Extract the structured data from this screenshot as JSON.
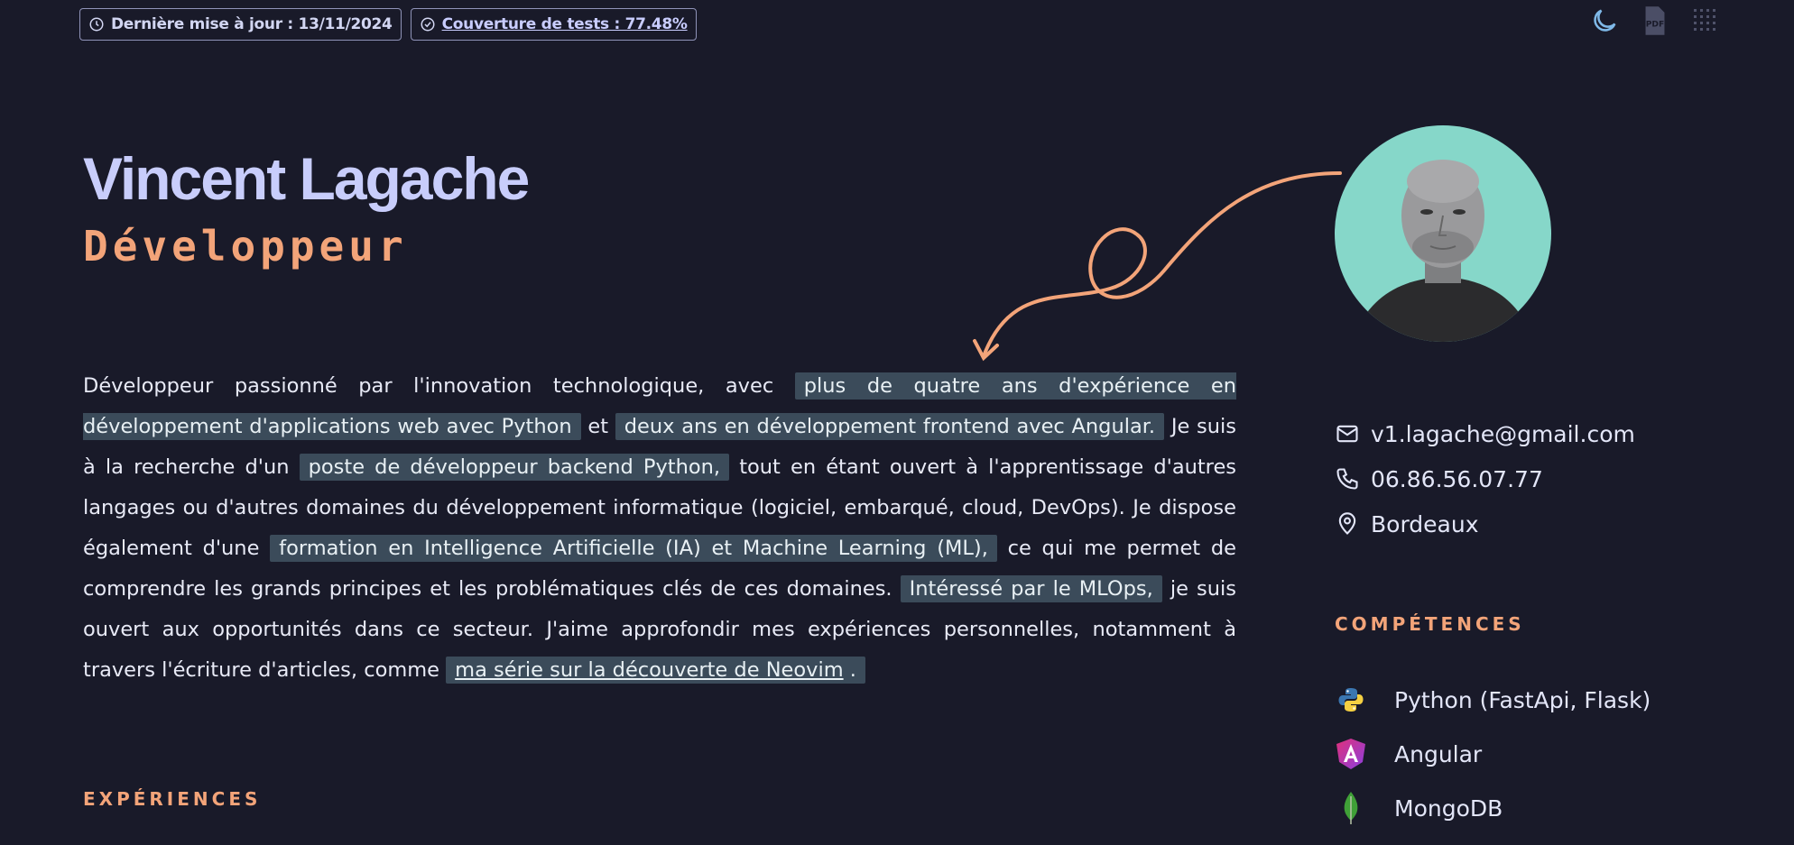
{
  "header": {
    "last_update": "Dernière mise à jour : 13/11/2024",
    "test_coverage": "Couverture de tests : 77.48%",
    "icons": [
      "moon-icon",
      "pdf-icon",
      "grid-icon"
    ]
  },
  "hero": {
    "name": "Vincent Lagache",
    "role": "Développeur"
  },
  "bio": {
    "p1": "Développeur passionné par l'innovation technologique, avec ",
    "h1": "plus de quatre ans d'expérience en développement d'applications web avec Python",
    "p2": " et ",
    "h2": "deux ans en développement frontend avec Angular.",
    "p3": " Je suis à la recherche d'un ",
    "h3": "poste de développeur backend Python,",
    "p4": " tout en étant ouvert à l'apprentissage d'autres langages ou d'autres domaines du développement informatique (logiciel, embarqué, cloud, DevOps). Je dispose également d'une ",
    "h4": "formation en Intelligence Artificielle (IA) et Machine Learning (ML),",
    "p5": " ce qui me permet de comprendre les grands principes et les problématiques clés de ces domaines. ",
    "h5": "Intéressé par le MLOps,",
    "p6": " je suis ouvert aux opportunités dans ce secteur. J'aime approfondir mes expériences personnelles, notamment à travers l'écriture d'articles, comme ",
    "link": "ma série sur la découverte de Neovim",
    "link_suffix": " ."
  },
  "contact": {
    "email": "v1.lagache@gmail.com",
    "phone": "06.86.56.07.77",
    "city": "Bordeaux"
  },
  "sections": {
    "skills_title": "COMPÉTENCES",
    "experiences_title": "EXPÉRIENCES"
  },
  "skills": [
    {
      "label": "Python (FastApi, Flask)",
      "icon": "python-icon"
    },
    {
      "label": "Angular",
      "icon": "angular-icon"
    },
    {
      "label": "MongoDB",
      "icon": "mongodb-icon"
    }
  ],
  "colors": {
    "background": "#191a29",
    "accent": "#f3a479",
    "name": "#c8cdfb",
    "highlight": "#3b4b5a"
  }
}
